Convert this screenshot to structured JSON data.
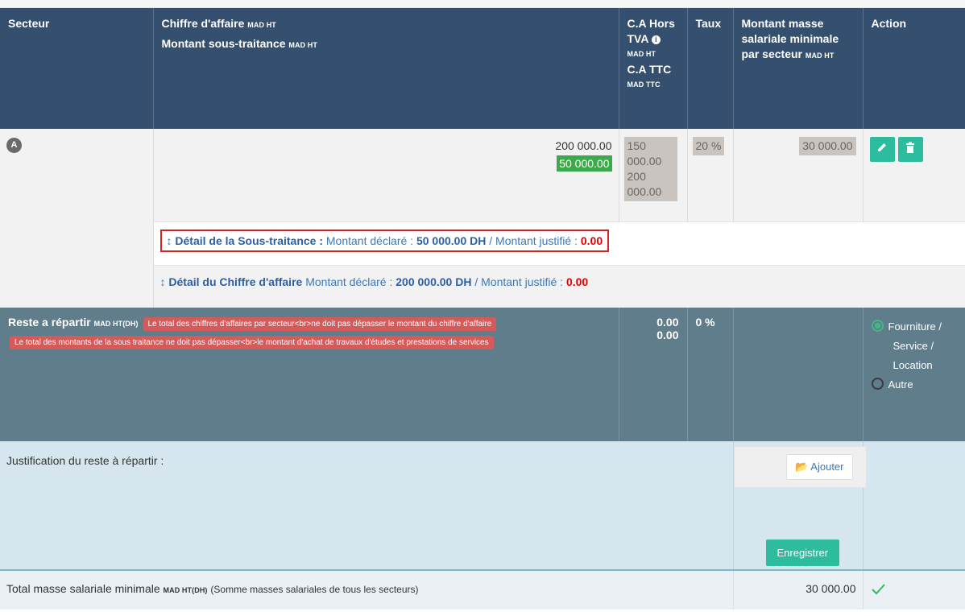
{
  "header": {
    "secteur": "Secteur",
    "ca_label": "Chiffre d'affaire",
    "ca_unit": "MAD HT",
    "st_label": "Montant sous-traitance",
    "st_unit": "MAD HT",
    "ca_hors_tva": "C.A Hors TVA",
    "ca_hors_unit": "MAD HT",
    "ca_ttc": "C.A TTC",
    "ca_ttc_unit": "MAD TTC",
    "taux": "Taux",
    "masse_label": "Montant masse salariale minimale par secteur",
    "masse_unit": "MAD HT",
    "action": "Action"
  },
  "row": {
    "sector_badge": "A",
    "ca": "200 000.00",
    "st": "50 000.00",
    "ca_hors_tva": "150 000.00",
    "ca_ttc": "200 000.00",
    "taux": "20 %",
    "masse": "30 000.00"
  },
  "details": {
    "st": {
      "label": "Détail de la Sous-traitance :",
      "declared_text": "Montant déclaré :",
      "declared": "50 000.00 DH",
      "sep": "/",
      "justified_text": "Montant justifié :",
      "justified": "0.00"
    },
    "ca": {
      "label": "Détail du Chiffre d'affaire",
      "declared_text": "Montant déclaré :",
      "declared": "200 000.00 DH",
      "sep": "/",
      "justified_text": "Montant justifié :",
      "justified": "0.00"
    }
  },
  "reste": {
    "label": "Reste a répartir",
    "unit": "MAD HT(DH)",
    "err1": "Le total des chiffres d'affaires par secteur<br>ne doit pas dépasser le montant du chiffre d'affaire",
    "err2": "Le total des montants de la sous traitance ne doit pas dépasser<br>le montant d'achat de travaux d'études et prestations de services",
    "v1": "0.00",
    "v2": "0.00",
    "taux": "0 %",
    "opt1_a": "Fourniture /",
    "opt1_b": "Service /",
    "opt1_c": "Location",
    "opt2": "Autre"
  },
  "justif": {
    "label": "Justification du reste à répartir :",
    "add_label": "Ajouter",
    "save_label": "Enregistrer"
  },
  "total": {
    "label": "Total masse salariale minimale",
    "unit": "MAD HT(DH)",
    "note": "(Somme masses salariales de tous les secteurs)",
    "value": "30 000.00"
  },
  "colors": {
    "header": "#35506f",
    "teal_button": "#2ebc9e",
    "reste_bg": "#607d8b",
    "justif_bg": "#d5e6ee"
  }
}
